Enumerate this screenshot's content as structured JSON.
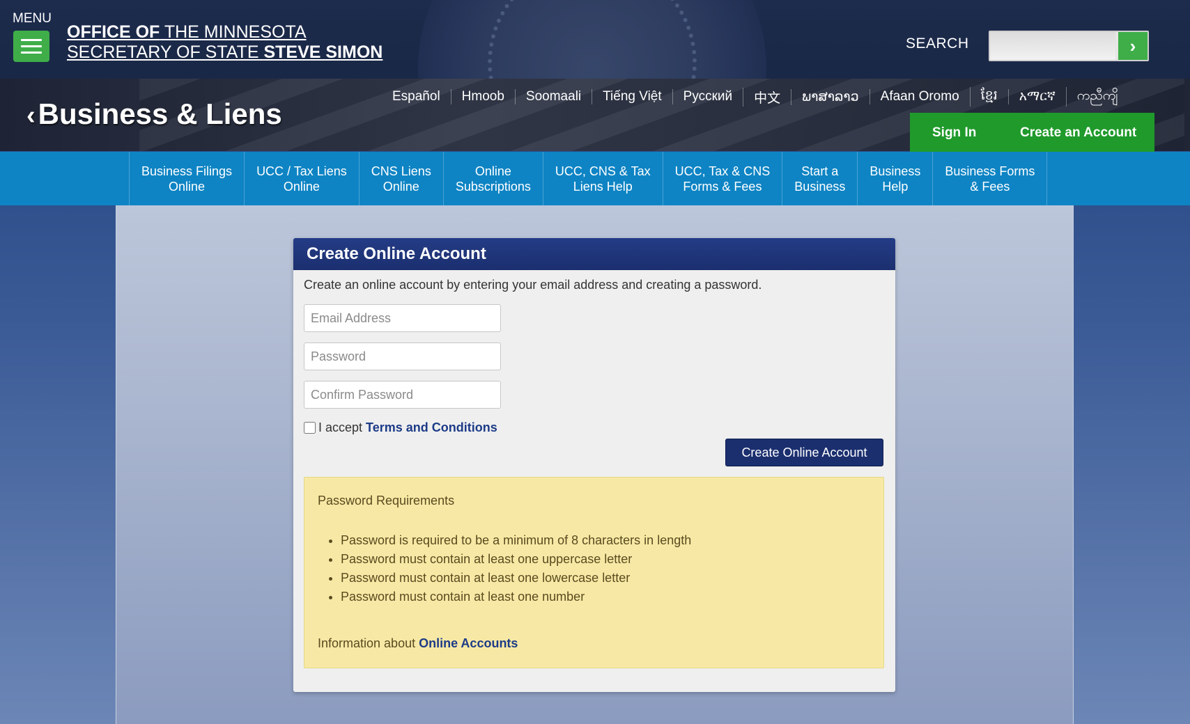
{
  "header": {
    "menu_label": "MENU",
    "office_line1_bold": "OFFICE OF",
    "office_line1_rest": " THE MINNESOTA",
    "office_line2_rest": "SECRETARY OF STATE ",
    "office_line2_bold": "STEVE SIMON",
    "search_label": "SEARCH",
    "search_placeholder": "",
    "search_go": "›"
  },
  "subheader": {
    "title": "Business & Liens",
    "languages": [
      "Español",
      "Hmoob",
      "Soomaali",
      "Tiếng Việt",
      "Русский",
      "中文",
      "ພາສາລາວ",
      "Afaan Oromo",
      "ខ្មែរ",
      "አማርኛ",
      "ကညီကျိ"
    ],
    "sign_in": "Sign In",
    "create_account": "Create an Account"
  },
  "nav": {
    "items": [
      {
        "line1": "Business Filings",
        "line2": "Online"
      },
      {
        "line1": "UCC / Tax Liens",
        "line2": "Online"
      },
      {
        "line1": "CNS Liens",
        "line2": "Online"
      },
      {
        "line1": "Online",
        "line2": "Subscriptions"
      },
      {
        "line1": "UCC, CNS & Tax",
        "line2": "Liens Help"
      },
      {
        "line1": "UCC, Tax & CNS",
        "line2": "Forms & Fees"
      },
      {
        "line1": "Start a",
        "line2": "Business"
      },
      {
        "line1": "Business",
        "line2": "Help"
      },
      {
        "line1": "Business Forms",
        "line2": "& Fees"
      }
    ]
  },
  "form": {
    "title": "Create Online Account",
    "intro": "Create an online account by entering your email address and creating a password.",
    "email_placeholder": "Email Address",
    "password_placeholder": "Password",
    "confirm_placeholder": "Confirm Password",
    "terms_prefix": "I accept",
    "terms_link": "Terms and Conditions",
    "submit_label": "Create Online Account"
  },
  "requirements": {
    "title": "Password Requirements",
    "items": [
      "Password is required to be a minimum of 8 characters in length",
      "Password must contain at least one uppercase letter",
      "Password must contain at least one lowercase letter",
      "Password must contain at least one number"
    ],
    "info_prefix": "Information about",
    "info_link": "Online Accounts"
  },
  "colors": {
    "header_bg": "#1d2b4c",
    "green": "#3fae49",
    "nav_blue": "#0e84c4",
    "card_header": "#1b2f6f",
    "requirements_bg": "#f7e9a5"
  }
}
